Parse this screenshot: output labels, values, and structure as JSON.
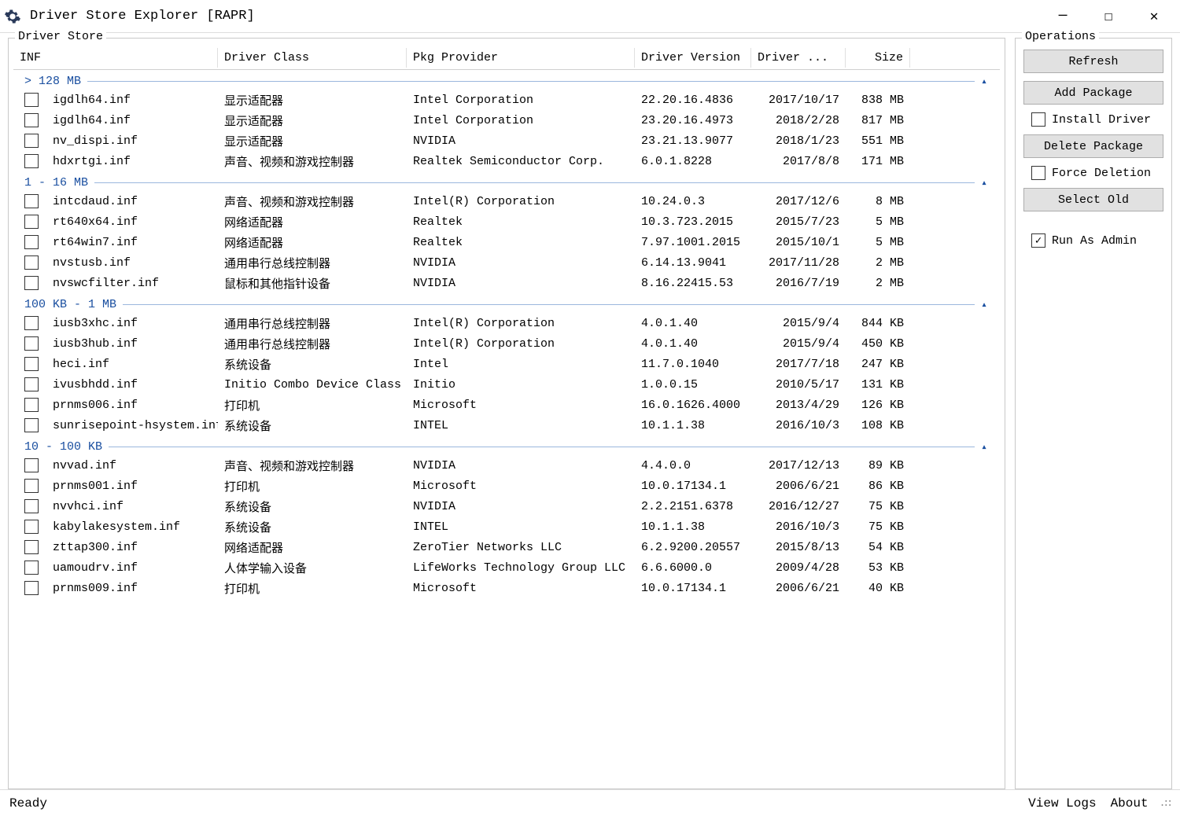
{
  "window": {
    "title": "Driver Store Explorer [RAPR]"
  },
  "panels": {
    "driver_store": "Driver Store",
    "operations": "Operations"
  },
  "columns": {
    "inf": "INF",
    "class": "Driver Class",
    "provider": "Pkg Provider",
    "version": "Driver Version",
    "date": "Driver ...",
    "size": "Size"
  },
  "groups": [
    {
      "label": "> 128 MB",
      "rows": [
        {
          "inf": "igdlh64.inf",
          "class": "显示适配器",
          "provider": "Intel Corporation",
          "version": "22.20.16.4836",
          "date": "2017/10/17",
          "size": "838 MB"
        },
        {
          "inf": "igdlh64.inf",
          "class": "显示适配器",
          "provider": "Intel Corporation",
          "version": "23.20.16.4973",
          "date": "2018/2/28",
          "size": "817 MB"
        },
        {
          "inf": "nv_dispi.inf",
          "class": "显示适配器",
          "provider": "NVIDIA",
          "version": "23.21.13.9077",
          "date": "2018/1/23",
          "size": "551 MB"
        },
        {
          "inf": "hdxrtgi.inf",
          "class": "声音、视频和游戏控制器",
          "provider": "Realtek Semiconductor Corp.",
          "version": "6.0.1.8228",
          "date": "2017/8/8",
          "size": "171 MB"
        }
      ]
    },
    {
      "label": "1 - 16 MB",
      "rows": [
        {
          "inf": "intcdaud.inf",
          "class": "声音、视频和游戏控制器",
          "provider": "Intel(R) Corporation",
          "version": "10.24.0.3",
          "date": "2017/12/6",
          "size": "8 MB"
        },
        {
          "inf": "rt640x64.inf",
          "class": "网络适配器",
          "provider": "Realtek",
          "version": "10.3.723.2015",
          "date": "2015/7/23",
          "size": "5 MB"
        },
        {
          "inf": "rt64win7.inf",
          "class": "网络适配器",
          "provider": "Realtek",
          "version": "7.97.1001.2015",
          "date": "2015/10/1",
          "size": "5 MB"
        },
        {
          "inf": "nvstusb.inf",
          "class": "通用串行总线控制器",
          "provider": "NVIDIA",
          "version": "6.14.13.9041",
          "date": "2017/11/28",
          "size": "2 MB"
        },
        {
          "inf": "nvswcfilter.inf",
          "class": "鼠标和其他指针设备",
          "provider": "NVIDIA",
          "version": "8.16.22415.53",
          "date": "2016/7/19",
          "size": "2 MB"
        }
      ]
    },
    {
      "label": "100 KB - 1 MB",
      "rows": [
        {
          "inf": "iusb3xhc.inf",
          "class": "通用串行总线控制器",
          "provider": "Intel(R) Corporation",
          "version": "4.0.1.40",
          "date": "2015/9/4",
          "size": "844 KB"
        },
        {
          "inf": "iusb3hub.inf",
          "class": "通用串行总线控制器",
          "provider": "Intel(R) Corporation",
          "version": "4.0.1.40",
          "date": "2015/9/4",
          "size": "450 KB"
        },
        {
          "inf": "heci.inf",
          "class": "系统设备",
          "provider": "Intel",
          "version": "11.7.0.1040",
          "date": "2017/7/18",
          "size": "247 KB"
        },
        {
          "inf": "ivusbhdd.inf",
          "class": "Initio Combo Device Class",
          "provider": "Initio",
          "version": "1.0.0.15",
          "date": "2010/5/17",
          "size": "131 KB"
        },
        {
          "inf": "prnms006.inf",
          "class": "打印机",
          "provider": "Microsoft",
          "version": "16.0.1626.4000",
          "date": "2013/4/29",
          "size": "126 KB"
        },
        {
          "inf": "sunrisepoint-hsystem.inf",
          "class": "系统设备",
          "provider": "INTEL",
          "version": "10.1.1.38",
          "date": "2016/10/3",
          "size": "108 KB"
        }
      ]
    },
    {
      "label": "10 - 100 KB",
      "rows": [
        {
          "inf": "nvvad.inf",
          "class": "声音、视频和游戏控制器",
          "provider": "NVIDIA",
          "version": "4.4.0.0",
          "date": "2017/12/13",
          "size": "89 KB"
        },
        {
          "inf": "prnms001.inf",
          "class": "打印机",
          "provider": "Microsoft",
          "version": "10.0.17134.1",
          "date": "2006/6/21",
          "size": "86 KB"
        },
        {
          "inf": "nvvhci.inf",
          "class": "系统设备",
          "provider": "NVIDIA",
          "version": "2.2.2151.6378",
          "date": "2016/12/27",
          "size": "75 KB"
        },
        {
          "inf": "kabylakesystem.inf",
          "class": "系统设备",
          "provider": "INTEL",
          "version": "10.1.1.38",
          "date": "2016/10/3",
          "size": "75 KB"
        },
        {
          "inf": "zttap300.inf",
          "class": "网络适配器",
          "provider": "ZeroTier Networks LLC",
          "version": "6.2.9200.20557",
          "date": "2015/8/13",
          "size": "54 KB"
        },
        {
          "inf": "uamoudrv.inf",
          "class": "人体学输入设备",
          "provider": "LifeWorks Technology Group LLC",
          "version": "6.6.6000.0",
          "date": "2009/4/28",
          "size": "53 KB"
        },
        {
          "inf": "prnms009.inf",
          "class": "打印机",
          "provider": "Microsoft",
          "version": "10.0.17134.1",
          "date": "2006/6/21",
          "size": "40 KB"
        }
      ]
    }
  ],
  "ops": {
    "refresh": "Refresh",
    "add_package": "Add Package",
    "install_driver": "Install Driver",
    "delete_package": "Delete Package",
    "force_deletion": "Force Deletion",
    "select_old": "Select Old",
    "run_as_admin": "Run As Admin"
  },
  "status": {
    "ready": "Ready",
    "view_logs": "View Logs",
    "about": "About"
  }
}
